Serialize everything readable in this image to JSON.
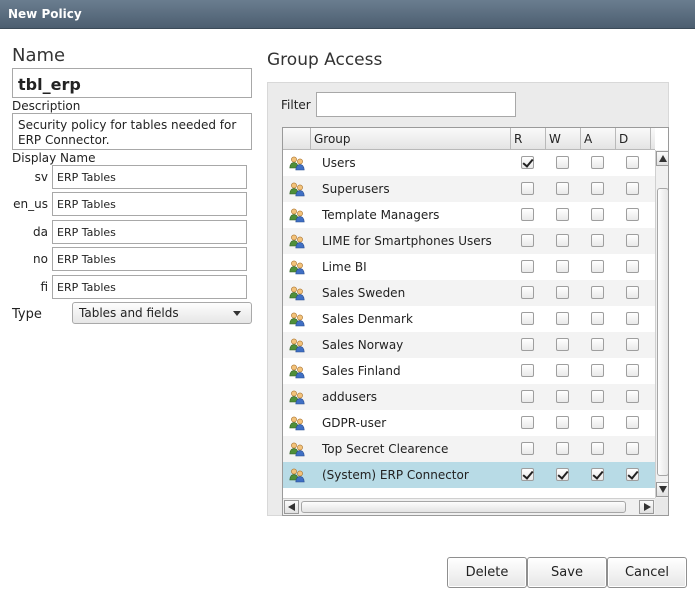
{
  "window": {
    "title": "New Policy"
  },
  "form": {
    "name_label": "Name",
    "name_value": "tbl_erp",
    "description_label": "Description",
    "description_line1": "Security policy for tables needed for",
    "description_line2": "ERP Connector.",
    "display_name_label": "Display Name",
    "display_names": [
      {
        "lang": "sv",
        "value": "ERP Tables"
      },
      {
        "lang": "en_us",
        "value": "ERP Tables"
      },
      {
        "lang": "da",
        "value": "ERP Tables"
      },
      {
        "lang": "no",
        "value": "ERP Tables"
      },
      {
        "lang": "fi",
        "value": "ERP Tables"
      }
    ],
    "type_label": "Type",
    "type_value": "Tables and fields"
  },
  "group_access": {
    "title": "Group Access",
    "filter_label": "Filter",
    "filter_value": "",
    "columns": {
      "group": "Group",
      "r": "R",
      "w": "W",
      "a": "A",
      "d": "D"
    },
    "rows": [
      {
        "name": "Users",
        "r": true,
        "w": false,
        "a": false,
        "d": false,
        "selected": false
      },
      {
        "name": "Superusers",
        "r": false,
        "w": false,
        "a": false,
        "d": false,
        "selected": false
      },
      {
        "name": "Template Managers",
        "r": false,
        "w": false,
        "a": false,
        "d": false,
        "selected": false
      },
      {
        "name": "LIME for Smartphones Users",
        "r": false,
        "w": false,
        "a": false,
        "d": false,
        "selected": false
      },
      {
        "name": "Lime BI",
        "r": false,
        "w": false,
        "a": false,
        "d": false,
        "selected": false
      },
      {
        "name": "Sales Sweden",
        "r": false,
        "w": false,
        "a": false,
        "d": false,
        "selected": false
      },
      {
        "name": "Sales Denmark",
        "r": false,
        "w": false,
        "a": false,
        "d": false,
        "selected": false
      },
      {
        "name": "Sales Norway",
        "r": false,
        "w": false,
        "a": false,
        "d": false,
        "selected": false
      },
      {
        "name": "Sales Finland",
        "r": false,
        "w": false,
        "a": false,
        "d": false,
        "selected": false
      },
      {
        "name": "addusers",
        "r": false,
        "w": false,
        "a": false,
        "d": false,
        "selected": false
      },
      {
        "name": "GDPR-user",
        "r": false,
        "w": false,
        "a": false,
        "d": false,
        "selected": false
      },
      {
        "name": "Top Secret Clearence",
        "r": false,
        "w": false,
        "a": false,
        "d": false,
        "selected": false
      },
      {
        "name": "(System) ERP Connector",
        "r": true,
        "w": true,
        "a": true,
        "d": true,
        "selected": true
      }
    ]
  },
  "buttons": {
    "delete": "Delete",
    "save": "Save",
    "cancel": "Cancel"
  },
  "colors": {
    "titlebar": "#4c5e70",
    "selected_row": "#b8dbe6",
    "panel": "#ebebeb"
  },
  "icons": {
    "group_row": "users-group-icon"
  }
}
